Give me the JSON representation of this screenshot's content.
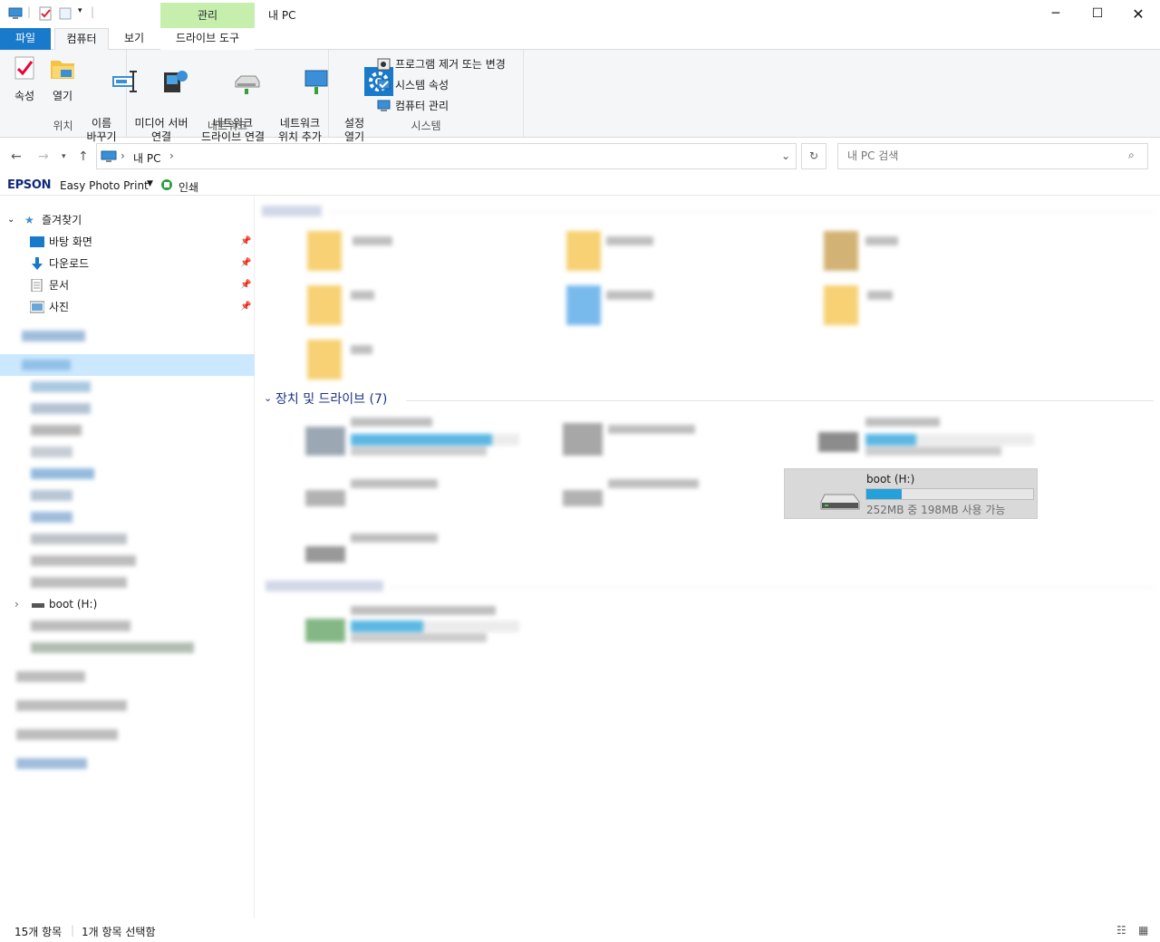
{
  "window": {
    "title": "내 PC",
    "context_tab": "관리"
  },
  "ribbon": {
    "tabs": [
      "파일",
      "컴퓨터",
      "보기",
      "드라이브 도구"
    ],
    "groups": {
      "location": {
        "label": "위치",
        "buttons": [
          {
            "label": "속성",
            "icon": "properties-icon"
          },
          {
            "label": "열기",
            "icon": "open-folder-icon"
          },
          {
            "label": "이름\n바꾸기",
            "icon": "rename-icon"
          }
        ]
      },
      "network": {
        "label": "네트워크",
        "buttons": [
          {
            "label": "미디어 서버\n연결",
            "icon": "media-server-icon"
          },
          {
            "label": "네트워크\n드라이브 연결",
            "icon": "network-drive-icon"
          },
          {
            "label": "네트워크\n위치 추가",
            "icon": "network-location-icon"
          }
        ]
      },
      "system": {
        "label": "시스템",
        "settings": "설정\n열기",
        "items": [
          "프로그램 제거 또는 변경",
          "시스템 속성",
          "컴퓨터 관리"
        ]
      }
    }
  },
  "address": {
    "crumbs": [
      "내 PC"
    ],
    "search_placeholder": "내 PC 검색"
  },
  "epson": {
    "brand": "EPSON",
    "app": "Easy Photo Print",
    "print": "인쇄"
  },
  "navpane": {
    "favorites": "즐겨찾기",
    "pinned": [
      "바탕 화면",
      "다운로드",
      "문서",
      "사진"
    ],
    "boot_drive": "boot (H:)"
  },
  "content": {
    "devices_header": "장치 및 드라이브 (7)",
    "selected_drive": {
      "label": "boot (H:)",
      "free_text": "252MB 중 198MB 사용 가능",
      "used_fraction": 0.21
    }
  },
  "status": {
    "count": "15개 항목",
    "selection": "1개 항목 선택함"
  },
  "colors": {
    "accent": "#1979ca",
    "context": "#c6efae",
    "selection": "#cce8ff",
    "bar": "#26a0da"
  }
}
